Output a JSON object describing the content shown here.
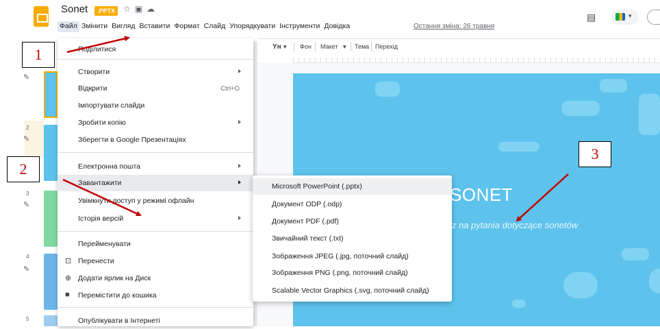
{
  "app": {
    "doc_title": "Sonet",
    "badge": ".PPTX",
    "last_edit": "Остання зміна: 26 травня"
  },
  "menubar": [
    {
      "label": "Файл"
    },
    {
      "label": "Змінити"
    },
    {
      "label": "Вигляд"
    },
    {
      "label": "Вставити"
    },
    {
      "label": "Формат"
    },
    {
      "label": "Слайд"
    },
    {
      "label": "Упорядкувати"
    },
    {
      "label": "Інструменти"
    },
    {
      "label": "Довідка"
    }
  ],
  "toolbar": {
    "text_style": "Yн",
    "background": "Фон",
    "layout": "Макет",
    "theme": "Тема",
    "transition": "Перехід"
  },
  "file_menu": {
    "share": "Поділитися",
    "new": "Створити",
    "open": "Відкрити",
    "open_shortcut": "Ctrl+O",
    "import_slides": "Імпортувати слайди",
    "make_copy": "Зробити копію",
    "save_as_slides": "Зберегти в Google Презентаціях",
    "email": "Електронна пошта",
    "download": "Завантажити",
    "offline": "Увімкнути доступ у режимі офлайн",
    "version_history": "Історія версій",
    "rename": "Перейменувати",
    "move": "Перенести",
    "add_shortcut": "Додати ярлик на Диск",
    "trash": "Перемістити до кошика",
    "publish": "Опублікувати в Інтернеті"
  },
  "download_submenu": [
    {
      "label": "Microsoft PowerPoint (.pptx)"
    },
    {
      "label": "Документ ODP (.odp)"
    },
    {
      "label": "Документ PDF (.pdf)"
    },
    {
      "label": "Звичайний текст (.txt)"
    },
    {
      "label": "Зображення JPEG (.jpg, поточний слайд)"
    },
    {
      "label": "Зображення PNG (.png, поточний слайд)"
    },
    {
      "label": "Scalable Vector Graphics (.svg, поточний слайд)"
    }
  ],
  "slide": {
    "title": "SONET",
    "subtitle": "lz na pytania dotyczące sonetów"
  },
  "thumbnails": {
    "n2": "2",
    "n3": "3",
    "n4": "4",
    "n5": "5"
  },
  "annotations": {
    "box1": "1",
    "box2": "2",
    "box3": "3",
    "arrow_color": "#c00000"
  }
}
